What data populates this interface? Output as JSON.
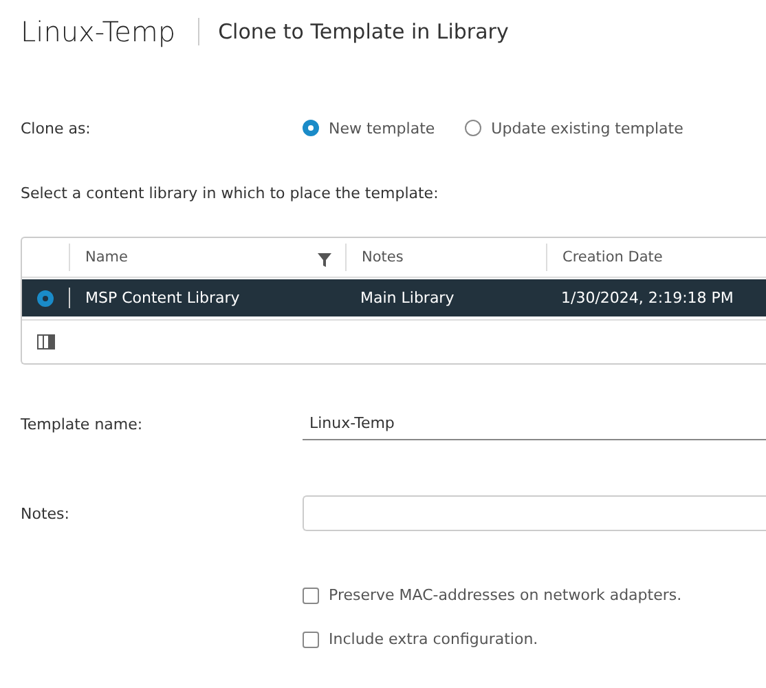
{
  "header": {
    "title": "Linux-Temp",
    "subtitle": "Clone to Template in Library"
  },
  "clone_as": {
    "label": "Clone as:",
    "options": [
      {
        "label": "New template",
        "selected": true
      },
      {
        "label": "Update existing template",
        "selected": false
      }
    ]
  },
  "library_prompt": "Select a content library in which to place the template:",
  "table": {
    "columns": [
      {
        "label": "Name",
        "filter": true
      },
      {
        "label": "Notes",
        "filter": false
      },
      {
        "label": "Creation Date",
        "filter": false
      }
    ],
    "rows": [
      {
        "selected": true,
        "cells": [
          "MSP Content Library",
          "Main Library",
          "1/30/2024, 2:19:18 PM"
        ]
      }
    ]
  },
  "template_name": {
    "label": "Template name:",
    "value": "Linux-Temp"
  },
  "notes": {
    "label": "Notes:"
  },
  "options": [
    {
      "label": "Preserve MAC-addresses on network adapters.",
      "checked": false
    },
    {
      "label": "Include extra configuration.",
      "checked": false
    }
  ]
}
